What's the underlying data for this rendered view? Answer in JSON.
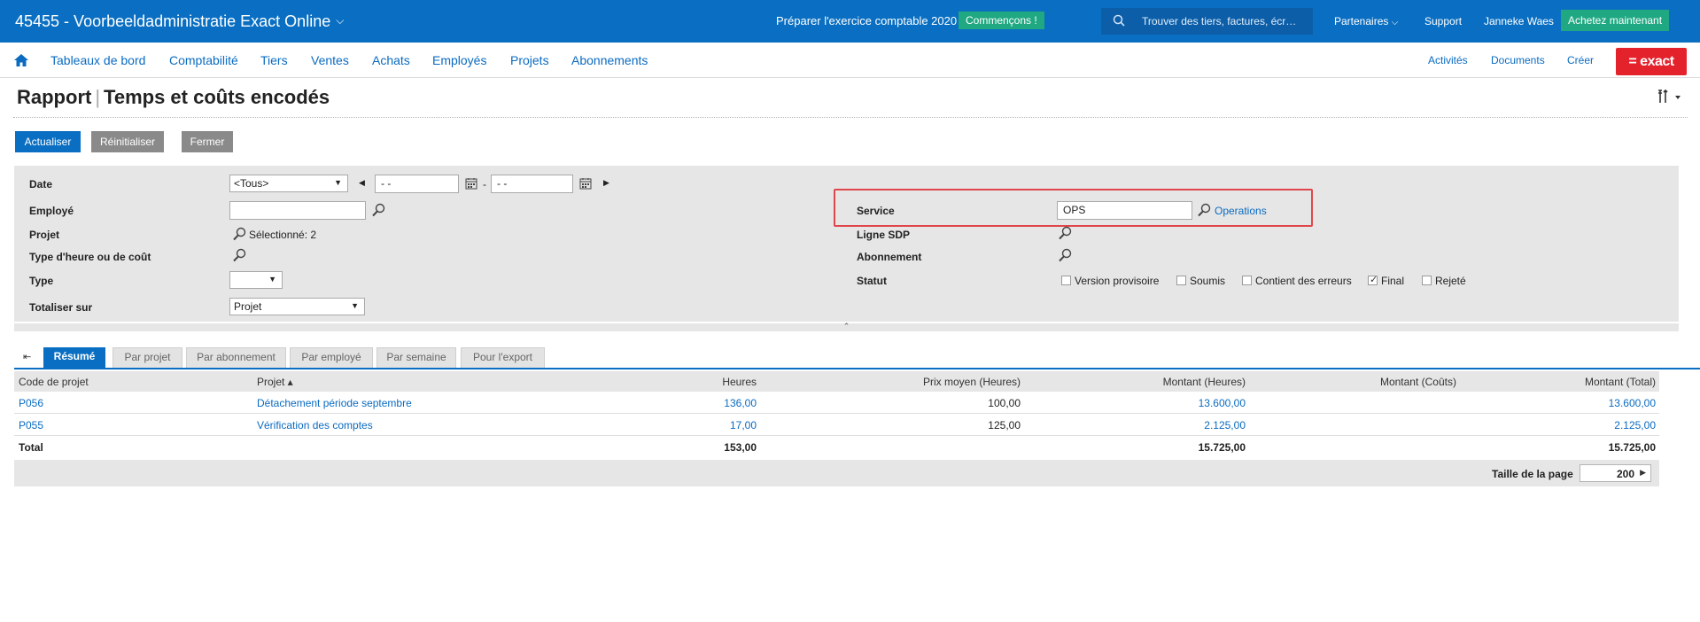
{
  "topbar": {
    "title": "45455 - Voorbeeldadministratie Exact Online",
    "prepare_text": "Préparer l'exercice comptable 2020",
    "start_button": "Commençons !",
    "search_placeholder": "Trouver des tiers, factures, écr…",
    "partners": "Partenaires",
    "support": "Support",
    "user": "Janneke Waes",
    "buy_button": "Achetez maintenant"
  },
  "nav": {
    "items": [
      "Tableaux de bord",
      "Comptabilité",
      "Tiers",
      "Ventes",
      "Achats",
      "Employés",
      "Projets",
      "Abonnements"
    ],
    "right_items": [
      "Activités",
      "Documents",
      "Créer"
    ],
    "logo": "= exact"
  },
  "page": {
    "title_part1": "Rapport",
    "title_part2": "Temps et coûts encodés"
  },
  "actions": {
    "refresh": "Actualiser",
    "reset": "Réinitialiser",
    "close": "Fermer"
  },
  "filters": {
    "date_label": "Date",
    "date_select": "<Tous>",
    "date_from": "- -",
    "date_to": "- -",
    "date_sep": "-",
    "employee_label": "Employé",
    "employee_value": "",
    "project_label": "Projet",
    "project_selected": "Sélectionné: 2",
    "hour_type_label": "Type d'heure ou de coût",
    "type_label": "Type",
    "type_value": "",
    "group_label": "Totaliser sur",
    "group_value": "Projet",
    "service_label": "Service",
    "service_value": "OPS",
    "service_link": "Operations",
    "sdp_label": "Ligne SDP",
    "subscription_label": "Abonnement",
    "status_label": "Statut",
    "statuses": [
      {
        "label": "Version provisoire",
        "checked": false
      },
      {
        "label": "Soumis",
        "checked": false
      },
      {
        "label": "Contient des erreurs",
        "checked": false
      },
      {
        "label": "Final",
        "checked": true
      },
      {
        "label": "Rejeté",
        "checked": false
      }
    ]
  },
  "tabs": [
    "Résumé",
    "Par projet",
    "Par abonnement",
    "Par employé",
    "Par semaine",
    "Pour l'export"
  ],
  "table": {
    "columns": [
      "Code de projet",
      "Projet ▴",
      "Heures",
      "Prix moyen (Heures)",
      "Montant (Heures)",
      "Montant (Coûts)",
      "Montant (Total)"
    ],
    "rows": [
      {
        "code": "P056",
        "project": "Détachement période septembre",
        "hours": "136,00",
        "avg_price": "100,00",
        "amount_hours": "13.600,00",
        "amount_costs": "",
        "amount_total": "13.600,00"
      },
      {
        "code": "P055",
        "project": "Vérification des comptes",
        "hours": "17,00",
        "avg_price": "125,00",
        "amount_hours": "2.125,00",
        "amount_costs": "",
        "amount_total": "2.125,00"
      }
    ],
    "total": {
      "label": "Total",
      "hours": "153,00",
      "amount_hours": "15.725,00",
      "amount_total": "15.725,00"
    },
    "page_size_label": "Taille de la page",
    "page_size": "200"
  },
  "colors": {
    "primary": "#0a6fc2",
    "green": "#1fa882",
    "exact_red": "#e4222c",
    "highlight": "#e0474c"
  }
}
